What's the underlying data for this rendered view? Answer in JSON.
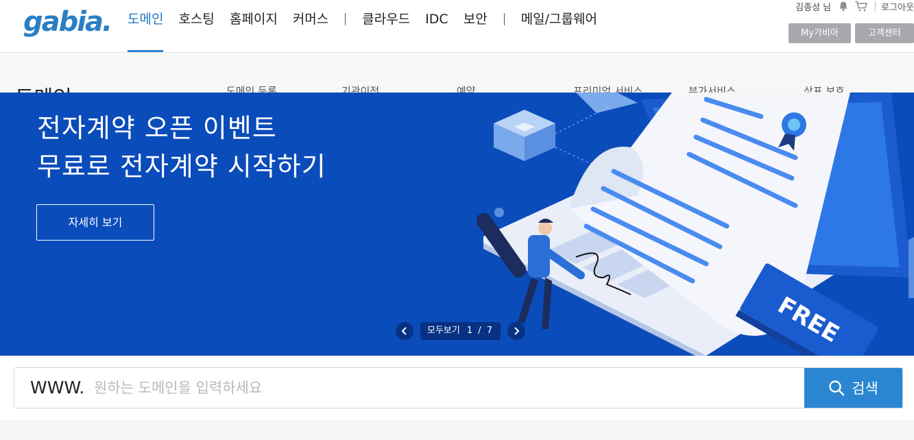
{
  "brand": {
    "logo_text": "gabia."
  },
  "gnb": {
    "items": [
      {
        "label": "도메인",
        "active": true
      },
      {
        "label": "호스팅"
      },
      {
        "label": "홈페이지"
      },
      {
        "label": "커머스"
      },
      {
        "label": "클라우드"
      },
      {
        "label": "IDC"
      },
      {
        "label": "보안"
      },
      {
        "label": "메일/그룹웨어"
      }
    ]
  },
  "util": {
    "user_name": "김종성 님",
    "logout": "로그아웃",
    "my_gabia": "My가비아",
    "customer_center": "고객센터"
  },
  "subbar": {
    "title": "도메인",
    "items": [
      "도메인 등록",
      "기관이전",
      "예약",
      "프리미엄 서비스",
      "부가서비스",
      "상표 보호"
    ]
  },
  "banner": {
    "title_line1": "전자계약 오픈 이벤트",
    "title_line2": "무료로 전자계약 시작하기",
    "detail_button": "자세히 보기",
    "view_all": "모두보기",
    "slide_counter": "1 / 7",
    "free_label": "FREE",
    "colors": {
      "background": "#0b4cbb",
      "accent": "#2a86d6"
    }
  },
  "search": {
    "prefix": "WWW.",
    "placeholder": "원하는 도메인을 입력하세요",
    "button_label": "검색"
  }
}
